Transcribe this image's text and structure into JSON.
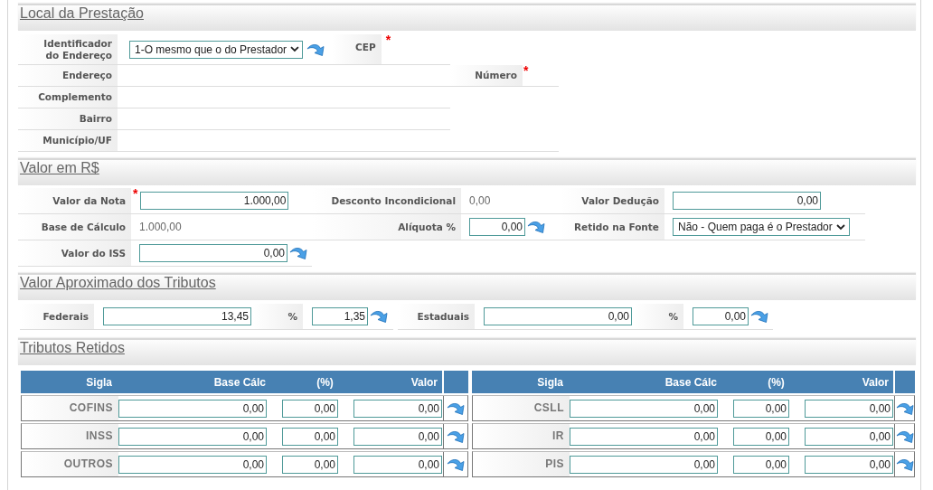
{
  "local": {
    "title": "Local da Prestação",
    "identificador": {
      "label": "Identificador do Endereço",
      "value": "1-O mesmo que o do Prestador",
      "action": true
    },
    "cep": {
      "label": "CEP",
      "required": "*"
    },
    "endereco": {
      "label": "Endereço"
    },
    "numero": {
      "label": "Número",
      "required": "*"
    },
    "complemento": {
      "label": "Complemento"
    },
    "bairro": {
      "label": "Bairro"
    },
    "municipio": {
      "label": "Município/UF"
    }
  },
  "valor": {
    "title": "Valor em R$",
    "rows": [
      [
        {
          "label": "Valor da Nota",
          "kind": "input",
          "value": "1.000,00",
          "required": "*"
        },
        {
          "label": "Desconto Incondicional",
          "kind": "text",
          "value": "0,00"
        },
        {
          "label": "Valor Dedução",
          "kind": "input",
          "value": "0,00"
        }
      ],
      [
        {
          "label": "Base de Cálculo",
          "kind": "text",
          "value": "1.000,00"
        },
        {
          "label": "Alíquota %",
          "kind": "input",
          "value": "0,00",
          "action": true
        },
        {
          "label": "Retido na Fonte",
          "kind": "select",
          "value": "Não - Quem paga é o Prestador"
        }
      ],
      [
        {
          "label": "Valor do ISS",
          "kind": "input",
          "value": "0,00",
          "action": true
        }
      ]
    ]
  },
  "aproximado": {
    "title": "Valor Aproximado dos Tributos",
    "groups": [
      [
        {
          "label": "Federais",
          "value": "13,45"
        },
        {
          "label": "%",
          "value": "1,35",
          "action": true
        }
      ],
      [
        {
          "label": "Estaduais",
          "value": "0,00"
        },
        {
          "label": "%",
          "value": "0,00",
          "action": true
        }
      ]
    ]
  },
  "retidos": {
    "title": "Tributos Retidos",
    "tables": [
      {
        "columns": [
          "Sigla",
          "Base Cálc",
          "(%)",
          "Valor"
        ],
        "rows": [
          {
            "sigla": "COFINS",
            "base": "0,00",
            "pct": "0,00",
            "valor": "0,00"
          },
          {
            "sigla": "INSS",
            "base": "0,00",
            "pct": "0,00",
            "valor": "0,00"
          },
          {
            "sigla": "OUTROS",
            "base": "0,00",
            "pct": "0,00",
            "valor": "0,00"
          }
        ]
      },
      {
        "columns": [
          "Sigla",
          "Base Cálc",
          "(%)",
          "Valor"
        ],
        "rows": [
          {
            "sigla": "CSLL",
            "base": "0,00",
            "pct": "0,00",
            "valor": "0,00"
          },
          {
            "sigla": "IR",
            "base": "0,00",
            "pct": "0,00",
            "valor": "0,00"
          },
          {
            "sigla": "PIS",
            "base": "0,00",
            "pct": "0,00",
            "valor": "0,00"
          }
        ]
      }
    ]
  }
}
